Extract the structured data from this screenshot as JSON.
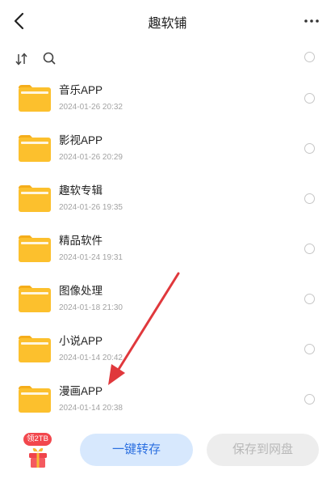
{
  "header": {
    "title": "趣软铺",
    "back_icon": "chevron-left-icon",
    "more_icon": "more-horizontal-icon"
  },
  "toolbar": {
    "sort_icon": "sort-icon",
    "search_icon": "search-icon"
  },
  "files": [
    {
      "name": "音乐APP",
      "date": "2024-01-26 20:32"
    },
    {
      "name": "影视APP",
      "date": "2024-01-26 20:29"
    },
    {
      "name": "趣软专辑",
      "date": "2024-01-26 19:35"
    },
    {
      "name": "精品软件",
      "date": "2024-01-24 19:31"
    },
    {
      "name": "图像处理",
      "date": "2024-01-18 21:30"
    },
    {
      "name": "小说APP",
      "date": "2024-01-14 20:42"
    },
    {
      "name": "漫画APP",
      "date": "2024-01-14 20:38"
    }
  ],
  "bottom": {
    "promo_badge": "领2TB",
    "save_one_click": "一键转存",
    "save_to_disk": "保存到网盘"
  },
  "colors": {
    "folder": "#fcc02d",
    "folder_tab": "#f5ad1a",
    "annotation_arrow": "#e0383c",
    "primary_button_bg": "#d7e8fd",
    "primary_button_text": "#2b6fe0"
  }
}
